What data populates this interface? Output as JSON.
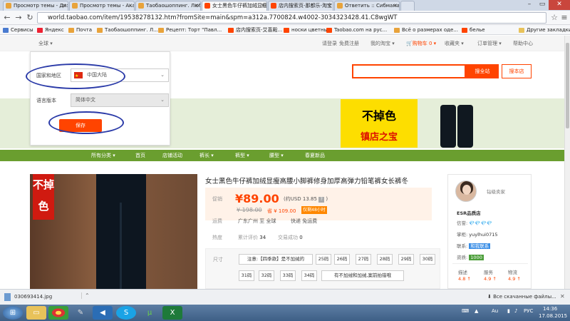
{
  "browser": {
    "tabs": [
      {
        "label": "Просмотр темы - Дизай",
        "color": "#e8a33b"
      },
      {
        "label": "Просмотр темы - Акади",
        "color": "#e8a33b"
      },
      {
        "label": "Таобаошоппинг. Любы",
        "color": "#e8a33b"
      },
      {
        "label": "女士黑色牛仔裤加绒显瘦",
        "color": "#f40",
        "active": true
      },
      {
        "label": "店内搜索页-那都乐-淘宝",
        "color": "#f40"
      },
      {
        "label": "Ответить :: Сибмама - о",
        "color": "#e8a33b"
      }
    ],
    "url": "world.taobao.com/item/19538278132.htm?fromSite=main&spm=a312a.7700824.w4002-3034323428.41.C8wgWT",
    "bookmarks": [
      {
        "label": "Сервисы",
        "color": "#4a7bd0"
      },
      {
        "label": "Яндекс",
        "color": "#e23"
      },
      {
        "label": "Почта",
        "color": "#e8a33b"
      },
      {
        "label": "Таобаошоппинг. Л...",
        "color": "#e8a33b"
      },
      {
        "label": "Рецепт: Торт \"Павл...",
        "color": "#e8a33b"
      },
      {
        "label": "店内搜索页-艾喜殿...",
        "color": "#f40"
      },
      {
        "label": "носки цветные",
        "color": "#f40"
      },
      {
        "label": "Taobao.com на рус...",
        "color": "#f40"
      },
      {
        "label": "Всё о размерах оде...",
        "color": "#e8a33b"
      },
      {
        "label": "белье",
        "color": "#f40"
      }
    ],
    "other_bookmarks": "Другие закладки"
  },
  "topnav": {
    "region": "全球",
    "login": "请登录",
    "register": "免费注册",
    "my_taobao": "我的淘宝",
    "cart": "购物车",
    "cart_count": "0",
    "fav": "收藏夹",
    "orders": "订单管理",
    "help": "帮助中心"
  },
  "region_panel": {
    "country_label": "国家和地区",
    "country_value": "中国大陆",
    "lang_label": "语言版本",
    "lang_value": "简体中文",
    "save": "保存"
  },
  "search": {
    "all": "搜全站",
    "shop": "搜本店"
  },
  "banner": {
    "line1": "不掉色",
    "line2": "镇店之宝"
  },
  "shop_nav": [
    "所有分类",
    "首页",
    "店铺活动",
    "裤长",
    "裤型",
    "腰型",
    "春夏新品"
  ],
  "product": {
    "image_badge": "不掉色",
    "title": "女士黑色牛仔裤加绒显瘦高腰小脚裤修身加厚高弹力铅笔裤女长裤冬",
    "promo_label": "促销",
    "price": "¥89.00",
    "usd": "(约USD 13.85",
    "old_price": "¥ 198.00",
    "new_price_prefix": "省 ¥ 109.00",
    "tag": "仅剩48小时",
    "ship_label": "运费",
    "ship_from": "广东广州 至 全球",
    "ship_note": "快递 免运费",
    "heat_label": "热度",
    "reviews": "累计评价",
    "reviews_count": "34",
    "sales": "交易成功",
    "sales_count": "0",
    "size_label": "尺寸",
    "size_note": "注意:【四季款】是不加绒的",
    "sizes_row1": [
      "25码",
      "26码",
      "27码",
      "28码",
      "29码",
      "30码"
    ],
    "sizes_row2": [
      "31码",
      "32码",
      "33码",
      "34码"
    ],
    "size_note2": "有不加绒和加绒,案前拍错哦"
  },
  "seller": {
    "level": "钻级卖家",
    "shop": "ESR品质店",
    "credit_label": "信誉:",
    "credit": "💎💎💎💎",
    "keeper_label": "掌柜:",
    "keeper": "yuylhui0715",
    "contact_label": "联系:",
    "contact": "和我联系",
    "qual_label": "资质:",
    "qual": "1000",
    "score_labels": [
      "描述",
      "服务",
      "物流"
    ],
    "scores": [
      "4.8 ↑",
      "4.9 ↑",
      "4.9 ↑"
    ]
  },
  "download": {
    "file": "030693414.jpg",
    "all": "Все скачанные файлы..."
  },
  "taskbar": {
    "lang": "РУС",
    "time": "14:36",
    "date": "17.08.2015"
  }
}
